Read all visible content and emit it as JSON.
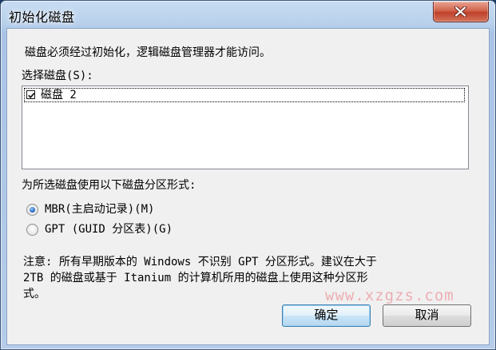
{
  "window": {
    "title": "初始化磁盘"
  },
  "intro_text": "磁盘必须经过初始化，逻辑磁盘管理器才能访问。",
  "select_label": "选择磁盘(S):",
  "disks": [
    {
      "label": "磁盘 2",
      "checked": true
    }
  ],
  "partition_label": "为所选磁盘使用以下磁盘分区形式:",
  "partition_options": [
    {
      "label": "MBR(主启动记录)(M)",
      "selected": true
    },
    {
      "label": "GPT (GUID 分区表)(G)",
      "selected": false
    }
  ],
  "note_lines": [
    "注意: 所有早期版本的 Windows 不识别 GPT 分区形式。建议在大于",
    "2TB 的磁盘或基于 Itanium 的计算机所用的磁盘上使用这种分区形",
    "式。"
  ],
  "buttons": {
    "ok": "确定",
    "cancel": "取消"
  },
  "watermark": "www.xzgzs.com",
  "colors": {
    "close_button": "#c0402a",
    "radio_selected": "#2a6fc8",
    "client_background": "#f0f0f0"
  },
  "icons": {
    "close": "close-icon",
    "check": "checkmark-icon"
  }
}
